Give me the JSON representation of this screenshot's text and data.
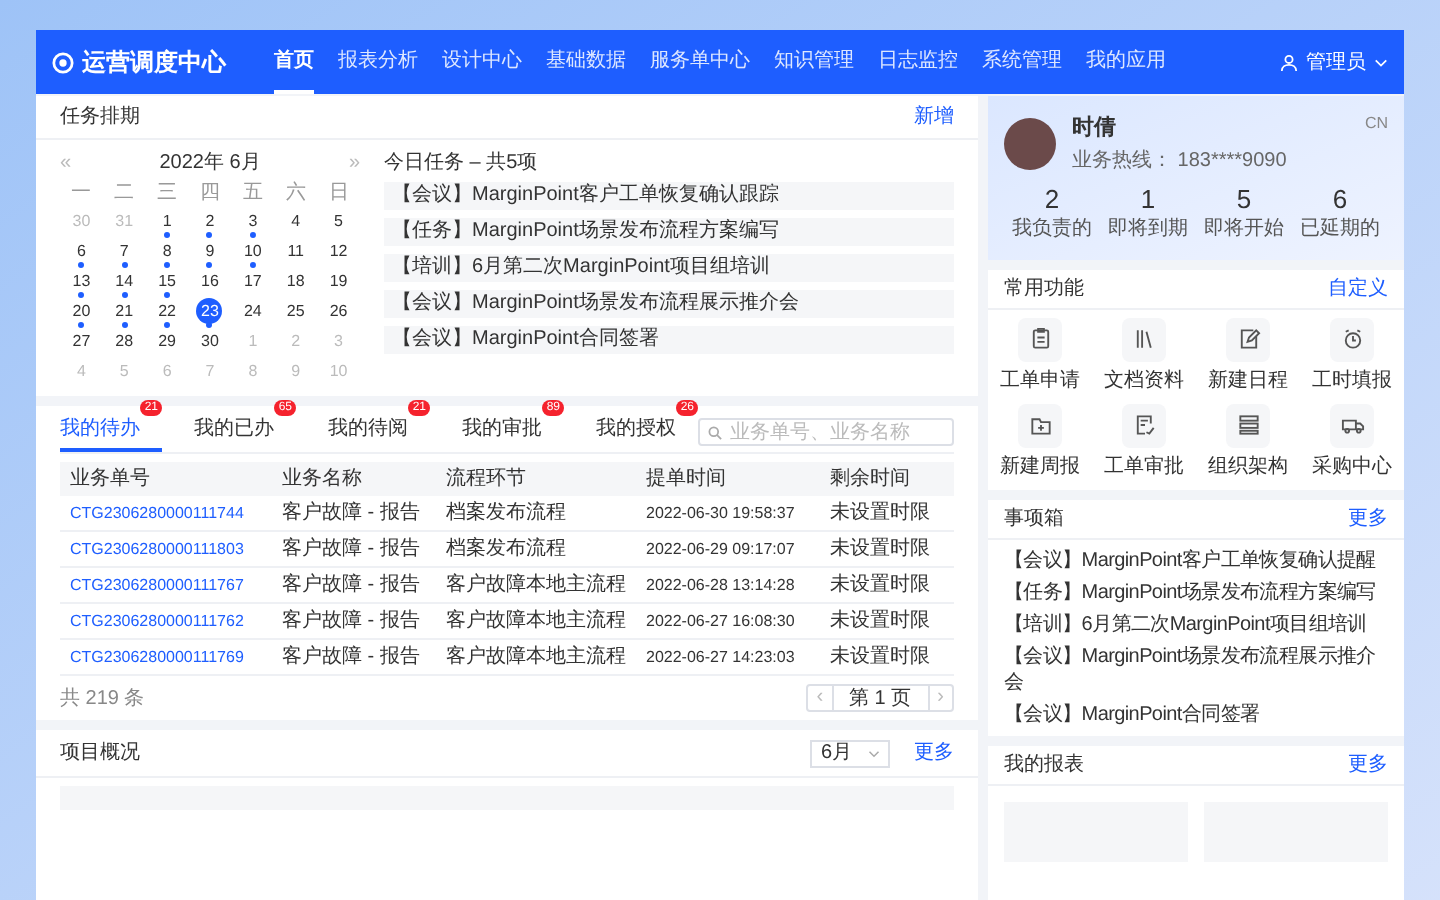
{
  "header": {
    "title": "运营调度中心",
    "nav": [
      {
        "label": "首页",
        "selected": true
      },
      {
        "label": "报表分析",
        "selected": false
      },
      {
        "label": "设计中心",
        "selected": false
      },
      {
        "label": "基础数据",
        "selected": false
      },
      {
        "label": "服务单中心",
        "selected": false
      },
      {
        "label": "知识管理",
        "selected": false
      },
      {
        "label": "日志监控",
        "selected": false
      },
      {
        "label": "系统管理",
        "selected": false
      },
      {
        "label": "我的应用",
        "selected": false
      }
    ],
    "user": "管理员"
  },
  "schedule": {
    "title": "任务排期",
    "action": "新增",
    "month": "2022年 6月",
    "prev": "«",
    "next": "»",
    "weekdays": [
      "一",
      "二",
      "三",
      "四",
      "五",
      "六",
      "日"
    ],
    "days": [
      {
        "label": "30",
        "muted": true,
        "has_task": false,
        "selected": false
      },
      {
        "label": "31",
        "muted": true,
        "has_task": false,
        "selected": false
      },
      {
        "label": "1",
        "muted": false,
        "has_task": true,
        "selected": false
      },
      {
        "label": "2",
        "muted": false,
        "has_task": true,
        "selected": false
      },
      {
        "label": "3",
        "muted": false,
        "has_task": true,
        "selected": false
      },
      {
        "label": "4",
        "muted": false,
        "has_task": false,
        "selected": false
      },
      {
        "label": "5",
        "muted": false,
        "has_task": false,
        "selected": false
      },
      {
        "label": "6",
        "muted": false,
        "has_task": true,
        "selected": false
      },
      {
        "label": "7",
        "muted": false,
        "has_task": true,
        "selected": false
      },
      {
        "label": "8",
        "muted": false,
        "has_task": true,
        "selected": false
      },
      {
        "label": "9",
        "muted": false,
        "has_task": true,
        "selected": false
      },
      {
        "label": "10",
        "muted": false,
        "has_task": true,
        "selected": false
      },
      {
        "label": "11",
        "muted": false,
        "has_task": false,
        "selected": false
      },
      {
        "label": "12",
        "muted": false,
        "has_task": false,
        "selected": false
      },
      {
        "label": "13",
        "muted": false,
        "has_task": true,
        "selected": false
      },
      {
        "label": "14",
        "muted": false,
        "has_task": true,
        "selected": false
      },
      {
        "label": "15",
        "muted": false,
        "has_task": true,
        "selected": false
      },
      {
        "label": "16",
        "muted": false,
        "has_task": false,
        "selected": false
      },
      {
        "label": "17",
        "muted": false,
        "has_task": false,
        "selected": false
      },
      {
        "label": "18",
        "muted": false,
        "has_task": false,
        "selected": false
      },
      {
        "label": "19",
        "muted": false,
        "has_task": false,
        "selected": false
      },
      {
        "label": "20",
        "muted": false,
        "has_task": true,
        "selected": false
      },
      {
        "label": "21",
        "muted": false,
        "has_task": true,
        "selected": false
      },
      {
        "label": "22",
        "muted": false,
        "has_task": true,
        "selected": false
      },
      {
        "label": "23",
        "muted": false,
        "has_task": true,
        "selected": true
      },
      {
        "label": "24",
        "muted": false,
        "has_task": false,
        "selected": false
      },
      {
        "label": "25",
        "muted": false,
        "has_task": false,
        "selected": false
      },
      {
        "label": "26",
        "muted": false,
        "has_task": false,
        "selected": false
      },
      {
        "label": "27",
        "muted": false,
        "has_task": false,
        "selected": false
      },
      {
        "label": "28",
        "muted": false,
        "has_task": false,
        "selected": false
      },
      {
        "label": "29",
        "muted": false,
        "has_task": false,
        "selected": false
      },
      {
        "label": "30",
        "muted": false,
        "has_task": false,
        "selected": false
      },
      {
        "label": "1",
        "muted": true,
        "has_task": false,
        "selected": false
      },
      {
        "label": "2",
        "muted": true,
        "has_task": false,
        "selected": false
      },
      {
        "label": "3",
        "muted": true,
        "has_task": false,
        "selected": false
      },
      {
        "label": "4",
        "muted": true,
        "has_task": false,
        "selected": false
      },
      {
        "label": "5",
        "muted": true,
        "has_task": false,
        "selected": false
      },
      {
        "label": "6",
        "muted": true,
        "has_task": false,
        "selected": false
      },
      {
        "label": "7",
        "muted": true,
        "has_task": false,
        "selected": false
      },
      {
        "label": "8",
        "muted": true,
        "has_task": false,
        "selected": false
      },
      {
        "label": "9",
        "muted": true,
        "has_task": false,
        "selected": false
      },
      {
        "label": "10",
        "muted": true,
        "has_task": false,
        "selected": false
      }
    ],
    "today_title": "今日任务 – 共5项",
    "tasks": [
      "【会议】MarginPoint客户工单恢复确认跟踪",
      "【任务】MarginPoint场景发布流程方案编写",
      "【培训】6月第二次MarginPoint项目组培训",
      "【会议】MarginPoint场景发布流程展示推介会",
      "【会议】MarginPoint合同签署"
    ]
  },
  "work": {
    "tabs": [
      {
        "label": "我的待办",
        "badge": "21",
        "selected": true
      },
      {
        "label": "我的已办",
        "badge": "65",
        "selected": false
      },
      {
        "label": "我的待阅",
        "badge": "21",
        "selected": false
      },
      {
        "label": "我的审批",
        "badge": "89",
        "selected": false
      },
      {
        "label": "我的授权",
        "badge": "26",
        "selected": false
      }
    ],
    "search": {
      "placeholder": "业务单号、业务名称"
    },
    "columns": [
      "业务单号",
      "业务名称",
      "流程环节",
      "提单时间",
      "剩余时间"
    ],
    "rows": [
      [
        "CTG2306280000111744",
        "客户故障 - 报告",
        "档案发布流程",
        "2022-06-30 19:58:37",
        "未设置时限"
      ],
      [
        "CTG2306280000111803",
        "客户故障 - 报告",
        "档案发布流程",
        "2022-06-29 09:17:07",
        "未设置时限"
      ],
      [
        "CTG2306280000111767",
        "客户故障 - 报告",
        "客户故障本地主流程",
        "2022-06-28 13:14:28",
        "未设置时限"
      ],
      [
        "CTG2306280000111762",
        "客户故障 - 报告",
        "客户故障本地主流程",
        "2022-06-27 16:08:30",
        "未设置时限"
      ],
      [
        "CTG2306280000111769",
        "客户故障 - 报告",
        "客户故障本地主流程",
        "2022-06-27 14:23:03",
        "未设置时限"
      ]
    ],
    "total": "共 219 条",
    "page": "第 1 页",
    "prev": "‹",
    "next": "›"
  },
  "project": {
    "title": "项目概况",
    "period": "6月",
    "more": "更多"
  },
  "profile": {
    "name": "时倩",
    "hotline": "业务热线： 183****9090",
    "lang": "CN",
    "stats": [
      {
        "value": "2",
        "label": "我负责的"
      },
      {
        "value": "1",
        "label": "即将到期"
      },
      {
        "value": "5",
        "label": "即将开始"
      },
      {
        "value": "6",
        "label": "已延期的"
      }
    ]
  },
  "shortcuts": {
    "title": "常用功能",
    "action": "自定义",
    "items": [
      {
        "label": "工单申请",
        "kind": "clipboard"
      },
      {
        "label": "文档资料",
        "kind": "books"
      },
      {
        "label": "新建日程",
        "kind": "edit"
      },
      {
        "label": "工时填报",
        "kind": "clock"
      },
      {
        "label": "新建周报",
        "kind": "folder"
      },
      {
        "label": "工单审批",
        "kind": "approve"
      },
      {
        "label": "组织架构",
        "kind": "org"
      },
      {
        "label": "采购中心",
        "kind": "truck"
      }
    ]
  },
  "inbox": {
    "title": "事项箱",
    "more": "更多",
    "items": [
      "【会议】MarginPoint客户工单恢复确认提醒",
      "【任务】MarginPoint场景发布流程方案编写",
      "【培训】6月第二次MarginPoint项目组培训",
      "【会议】MarginPoint场景发布流程展示推介会",
      "【会议】MarginPoint合同签署"
    ]
  },
  "reports": {
    "title": "我的报表",
    "more": "更多"
  }
}
